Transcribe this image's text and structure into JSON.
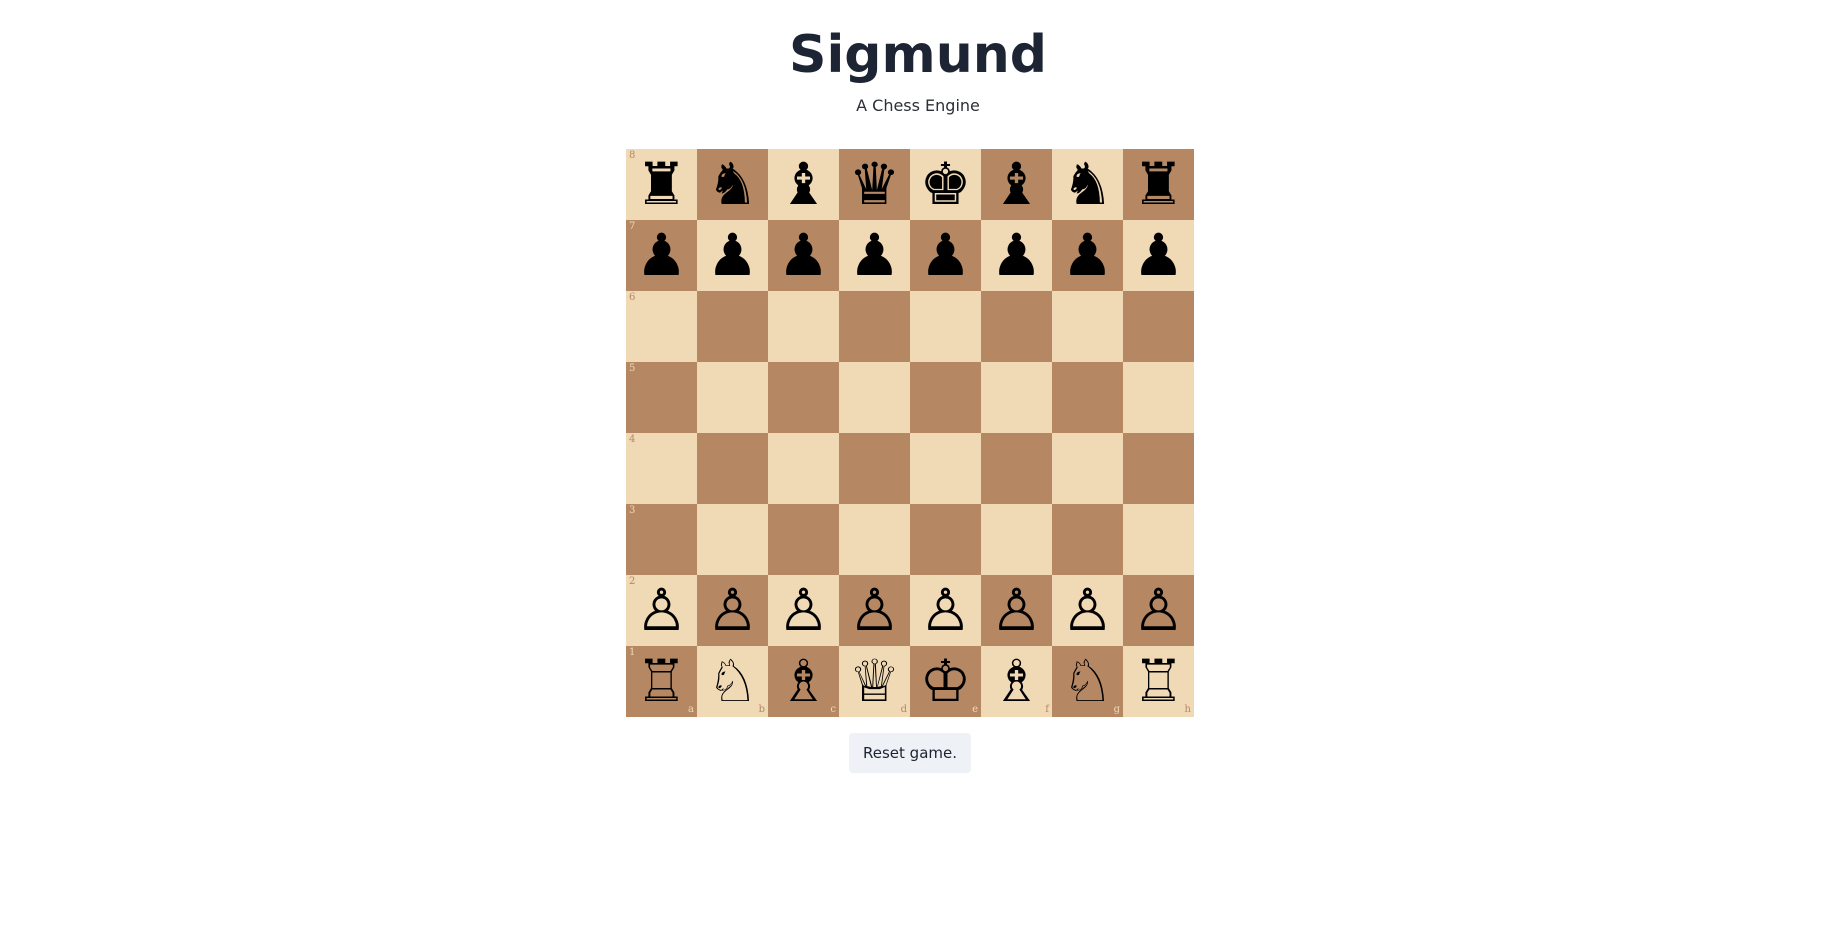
{
  "header": {
    "title": "Sigmund",
    "subtitle": "A Chess Engine"
  },
  "board": {
    "light_color": "#f0d9b5",
    "dark_color": "#b58863",
    "orientation": "white",
    "rank_labels": [
      "8",
      "7",
      "6",
      "5",
      "4",
      "3",
      "2",
      "1"
    ],
    "file_labels": [
      "a",
      "b",
      "c",
      "d",
      "e",
      "f",
      "g",
      "h"
    ],
    "position": [
      [
        "bR",
        "bN",
        "bB",
        "bQ",
        "bK",
        "bB",
        "bN",
        "bR"
      ],
      [
        "bP",
        "bP",
        "bP",
        "bP",
        "bP",
        "bP",
        "bP",
        "bP"
      ],
      [
        "",
        "",
        "",
        "",
        "",
        "",
        "",
        ""
      ],
      [
        "",
        "",
        "",
        "",
        "",
        "",
        "",
        ""
      ],
      [
        "",
        "",
        "",
        "",
        "",
        "",
        "",
        ""
      ],
      [
        "",
        "",
        "",
        "",
        "",
        "",
        "",
        ""
      ],
      [
        "wP",
        "wP",
        "wP",
        "wP",
        "wP",
        "wP",
        "wP",
        "wP"
      ],
      [
        "wR",
        "wN",
        "wB",
        "wQ",
        "wK",
        "wB",
        "wN",
        "wR"
      ]
    ],
    "piece_icons": {
      "bR": "black-rook-icon",
      "bN": "black-knight-icon",
      "bB": "black-bishop-icon",
      "bQ": "black-queen-icon",
      "bK": "black-king-icon",
      "bP": "black-pawn-icon",
      "wR": "white-rook-icon",
      "wN": "white-knight-icon",
      "wB": "white-bishop-icon",
      "wQ": "white-queen-icon",
      "wK": "white-king-icon",
      "wP": "white-pawn-icon"
    },
    "piece_glyphs": {
      "bR": "♜",
      "bN": "♞",
      "bB": "♝",
      "bQ": "♛",
      "bK": "♚",
      "bP": "♟",
      "wR": "♖",
      "wN": "♘",
      "wB": "♗",
      "wQ": "♕",
      "wK": "♔",
      "wP": "♙"
    }
  },
  "controls": {
    "reset_label": "Reset game."
  }
}
